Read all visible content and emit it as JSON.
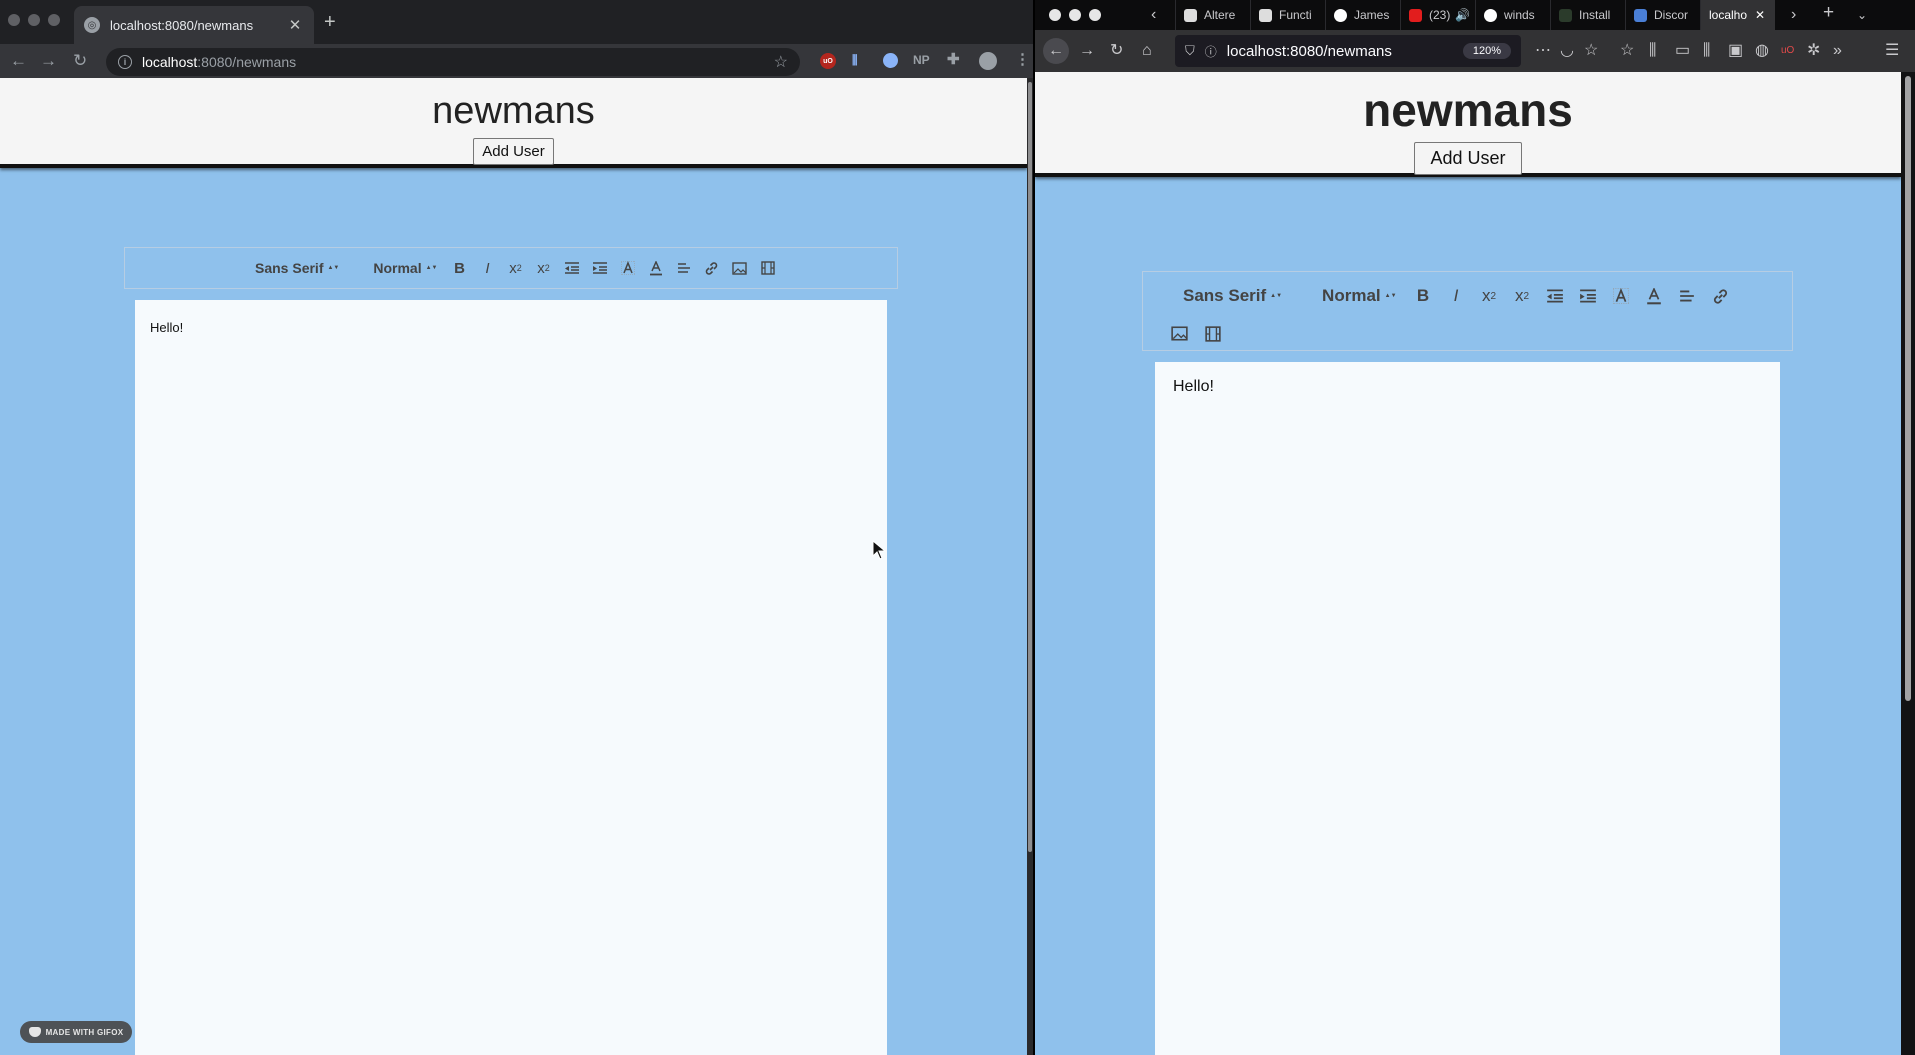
{
  "left_browser": {
    "tab_title": "localhost:8080/newmans",
    "url_host": "localhost",
    "url_rest": ":8080/newmans",
    "ext_np": "NP"
  },
  "right_browser": {
    "tabs": [
      "Altere",
      "Functi",
      "James",
      "(23)",
      "winds",
      "Install",
      "Discor",
      "localho"
    ],
    "url": "localhost:8080/newmans",
    "zoom": "120%"
  },
  "app": {
    "title": "newmans",
    "add_user_label": "Add User",
    "font_picker": "Sans Serif",
    "size_picker": "Normal",
    "editor_text": "Hello!"
  },
  "watermark": "MADE WITH GIFOX",
  "colors": {
    "page_bg": "#8fc1ec",
    "editor_bg": "#f6fafd",
    "header_bg": "#f5f5f5"
  }
}
